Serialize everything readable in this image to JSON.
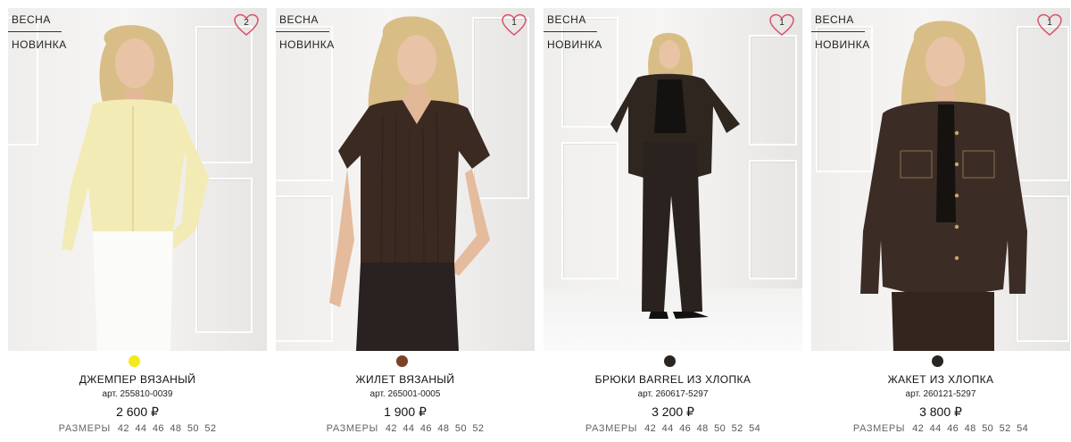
{
  "products": [
    {
      "tags": [
        "ВЕСНА",
        "НОВИНКА"
      ],
      "favorite_count": "2",
      "color": "#f4ea1a",
      "name": "ДЖЕМПЕР ВЯЗАНЫЙ",
      "article": "арт. 255810-0039",
      "price": "2 600 ₽",
      "sizes_label": "РАЗМЕРЫ",
      "sizes": "42 44 46 48 50 52"
    },
    {
      "tags": [
        "ВЕСНА",
        "НОВИНКА"
      ],
      "favorite_count": "1",
      "color": "#7a4325",
      "name": "ЖИЛЕТ ВЯЗАНЫЙ",
      "article": "арт. 265001-0005",
      "price": "1 900 ₽",
      "sizes_label": "РАЗМЕРЫ",
      "sizes": "42 44 46 48 50 52"
    },
    {
      "tags": [
        "ВЕСНА",
        "НОВИНКА"
      ],
      "favorite_count": "1",
      "color": "#2b2522",
      "name": "БРЮКИ BARREL ИЗ ХЛОПКА",
      "article": "арт. 260617-5297",
      "price": "3 200 ₽",
      "sizes_label": "РАЗМЕРЫ",
      "sizes": "42 44 46 48 50 52 54"
    },
    {
      "tags": [
        "ВЕСНА",
        "НОВИНКА"
      ],
      "favorite_count": "1",
      "color": "#2b2522",
      "name": "ЖАКЕТ ИЗ ХЛОПКА",
      "article": "арт. 260121-5297",
      "price": "3 800 ₽",
      "sizes_label": "РАЗМЕРЫ",
      "sizes": "42 44 46 48 50 52 54"
    }
  ],
  "icons": {
    "favorite": "heart-icon"
  },
  "colors": {
    "heart": "#d9506a",
    "sizes_text": "#666666"
  }
}
